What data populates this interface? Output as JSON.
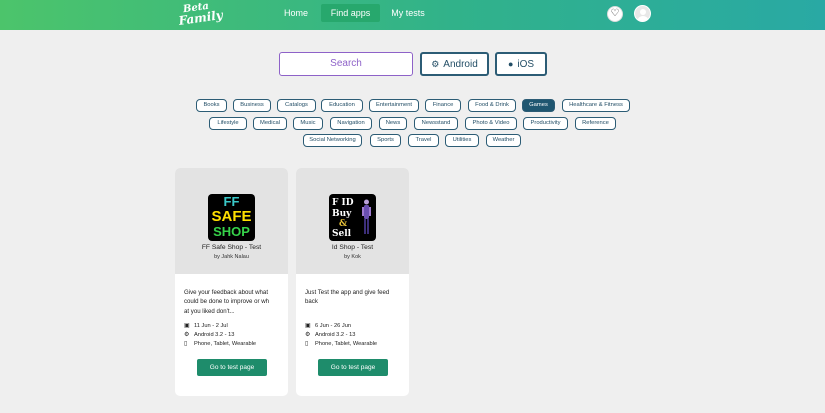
{
  "header": {
    "logo_line1": "Beta",
    "logo_line2": "Family",
    "nav": {
      "home": "Home",
      "find_apps": "Find apps",
      "my_tests": "My tests"
    }
  },
  "search": {
    "placeholder": "Search"
  },
  "platform_filters": {
    "android": "Android",
    "ios": "iOS"
  },
  "categories": [
    "Books",
    "Business",
    "Catalogs",
    "Education",
    "Entertainment",
    "Finance",
    "Food & Drink",
    "Games",
    "Healthcare & Fitness",
    "Lifestyle",
    "Medical",
    "Music",
    "Navigation",
    "News",
    "Newsstand",
    "Photo & Video",
    "Productivity",
    "Reference",
    "Social Networking",
    "Sports",
    "Travel",
    "Utilities",
    "Weather"
  ],
  "active_category": "Games",
  "apps": [
    {
      "icon_lines": [
        "FF",
        "SAFE",
        "SHOP"
      ],
      "name": "FF Safe Shop - Test",
      "by": "by Jahk Nalau",
      "desc_lines": [
        "Give your feedback about what",
        "could be done to improve or wh",
        "at you liked don't..."
      ],
      "dates": "11 Jun - 2 Jul",
      "os": "Android 3.2 - 13",
      "devices": "Phone, Tablet, Wearable",
      "button": "Go to test page"
    },
    {
      "icon_lines": [
        "F ID",
        "Buy",
        "&",
        "Sell"
      ],
      "name": "Id Shop - Test",
      "by": "by Kok",
      "desc_lines": [
        "Just Test the app and give feed",
        "back"
      ],
      "dates": "6 Jun - 26 Jun",
      "os": "Android 3.2 - 13",
      "devices": "Phone, Tablet, Wearable",
      "button": "Go to test page"
    }
  ],
  "colors": {
    "header_start": "#4cc46b",
    "header_end": "#29a9a4",
    "accent": "#1e8c6b",
    "chip_border": "#2c5c75",
    "chip_active": "#1f5670",
    "search_border": "#8e62c8"
  },
  "icons": {
    "calendar": "calendar-icon",
    "android": "android-icon",
    "device": "device-icon",
    "apple": "apple-icon",
    "notifications": "bell-icon",
    "user": "avatar"
  }
}
